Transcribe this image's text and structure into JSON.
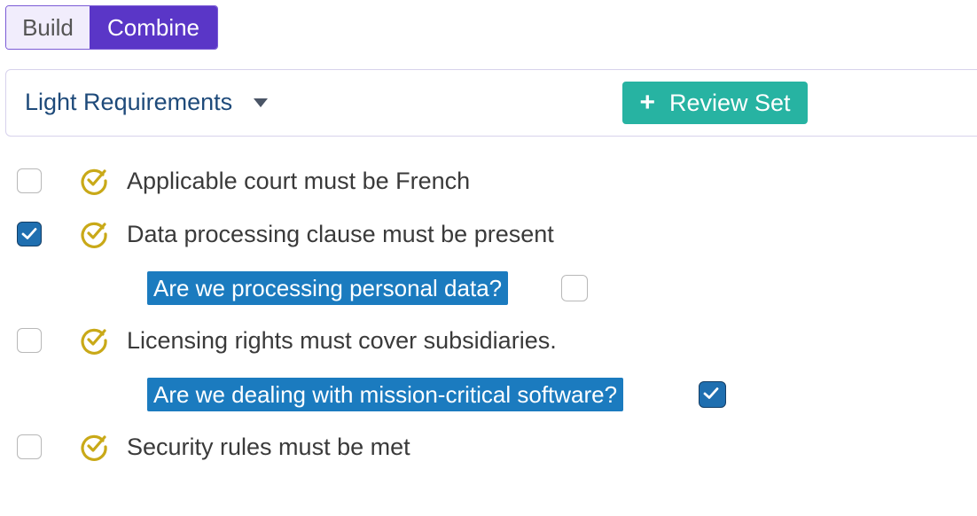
{
  "mode_toggle": {
    "build_label": "Build",
    "combine_label": "Combine",
    "active": "Combine"
  },
  "requirements_select": {
    "label": "Light Requirements"
  },
  "review_button": {
    "label": "Review Set"
  },
  "requirements": [
    {
      "text": "Applicable court must be French",
      "checked": false
    },
    {
      "text": "Data processing clause must be present",
      "checked": true,
      "question": {
        "text": "Are we processing personal data?",
        "checked": false
      }
    },
    {
      "text": "Licensing rights must cover subsidiaries.",
      "checked": false,
      "question": {
        "text": "Are we dealing with mission-critical software?",
        "checked": true
      }
    },
    {
      "text": "Security rules must be met",
      "checked": false
    }
  ],
  "colors": {
    "accent": "#5a36c7",
    "teal": "#27b3a2",
    "question_bg": "#1b7bbf",
    "icon_gold": "#c9a918"
  }
}
